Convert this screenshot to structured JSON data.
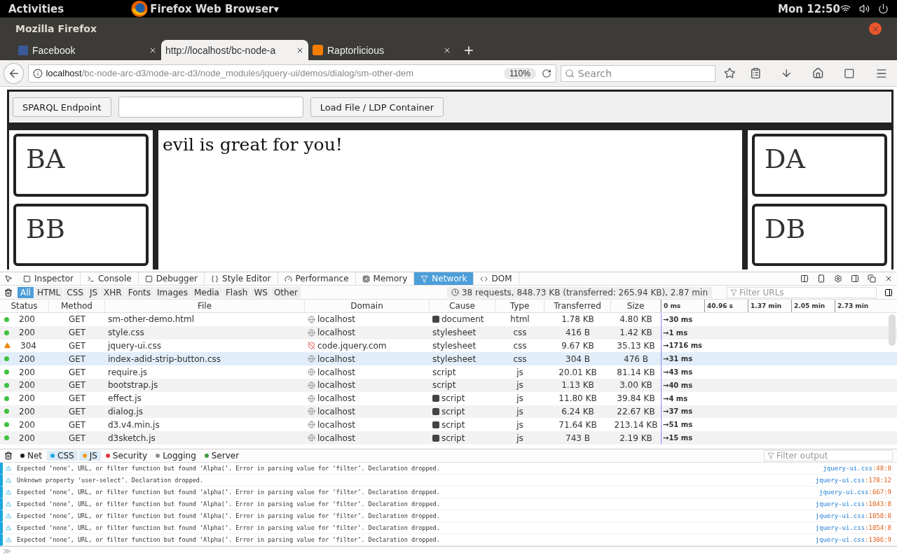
{
  "system_bar": {
    "activities": "Activities",
    "app_menu": "Firefox Web Browser▾",
    "clock": "Mon 12:50"
  },
  "window": {
    "title": "Mozilla Firefox"
  },
  "tabs": [
    {
      "label": "Facebook",
      "kind": "facebook",
      "selected": false
    },
    {
      "label": "http://localhost/bc-node-a",
      "kind": "page",
      "selected": true
    },
    {
      "label": "Raptorlicious",
      "kind": "blogger",
      "selected": false
    }
  ],
  "address_bar": {
    "host": "localhost",
    "path": "/bc-node-arc-d3/node-arc-d3/node_modules/jquery-ui/demos/dialog/sm-other-dem",
    "zoom": "110%"
  },
  "search": {
    "placeholder": "Search"
  },
  "page": {
    "toolbar": {
      "endpoint_button": "SPARQL Endpoint",
      "load_button": "Load File / LDP Container"
    },
    "left_boxes": [
      "BA",
      "BB"
    ],
    "main_text": "evil is great for you!",
    "right_boxes": [
      "DA",
      "DB"
    ]
  },
  "devtools": {
    "tabs": [
      {
        "label": "Inspector",
        "selected": false
      },
      {
        "label": "Console",
        "selected": false
      },
      {
        "label": "Debugger",
        "selected": false
      },
      {
        "label": "Style Editor",
        "selected": false
      },
      {
        "label": "Performance",
        "selected": false
      },
      {
        "label": "Memory",
        "selected": false
      },
      {
        "label": "Network",
        "selected": true
      },
      {
        "label": "DOM",
        "selected": false
      }
    ],
    "filters": [
      {
        "label": "All",
        "selected": true
      },
      {
        "label": "HTML",
        "selected": false
      },
      {
        "label": "CSS",
        "selected": false
      },
      {
        "label": "JS",
        "selected": false
      },
      {
        "label": "XHR",
        "selected": false
      },
      {
        "label": "Fonts",
        "selected": false
      },
      {
        "label": "Images",
        "selected": false
      },
      {
        "label": "Media",
        "selected": false
      },
      {
        "label": "Flash",
        "selected": false
      },
      {
        "label": "WS",
        "selected": false
      },
      {
        "label": "Other",
        "selected": false
      }
    ],
    "summary": "38 requests, 848.73 KB (transferred: 265.94 KB), 2.87 min",
    "filter_placeholder": "Filter URLs",
    "columns": [
      "Status",
      "Method",
      "File",
      "Domain",
      "Cause",
      "Type",
      "Transferred",
      "Size"
    ],
    "timeline_ticks": [
      "0 ms",
      "40.96 s",
      "1.37 min",
      "2.05 min",
      "2.73 min"
    ],
    "rows": [
      {
        "warning": false,
        "status": "200",
        "method": "GET",
        "file": "sm-other-demo.html",
        "insecure": false,
        "domain": "localhost",
        "cause_js": true,
        "cause": "document",
        "type": "html",
        "transferred": "1.78 KB",
        "size": "4.80 KB",
        "timing": "→30 ms",
        "selected": false
      },
      {
        "warning": false,
        "status": "200",
        "method": "GET",
        "file": "style.css",
        "insecure": false,
        "domain": "localhost",
        "cause_js": false,
        "cause": "stylesheet",
        "type": "css",
        "transferred": "416 B",
        "size": "1.42 KB",
        "timing": "→1 ms",
        "selected": false
      },
      {
        "warning": true,
        "status": "304",
        "method": "GET",
        "file": "jquery-ui.css",
        "insecure": true,
        "domain": "code.jquery.com",
        "cause_js": false,
        "cause": "stylesheet",
        "type": "css",
        "transferred": "9.67 KB",
        "size": "35.13 KB",
        "timing": "→1716 ms",
        "selected": false
      },
      {
        "warning": false,
        "status": "200",
        "method": "GET",
        "file": "index-adid-strip-button.css",
        "insecure": false,
        "domain": "localhost",
        "cause_js": false,
        "cause": "stylesheet",
        "type": "css",
        "transferred": "304 B",
        "size": "476 B",
        "timing": "→31 ms",
        "selected": true
      },
      {
        "warning": false,
        "status": "200",
        "method": "GET",
        "file": "require.js",
        "insecure": false,
        "domain": "localhost",
        "cause_js": false,
        "cause": "script",
        "type": "js",
        "transferred": "20.01 KB",
        "size": "81.14 KB",
        "timing": "→43 ms",
        "selected": false
      },
      {
        "warning": false,
        "status": "200",
        "method": "GET",
        "file": "bootstrap.js",
        "insecure": false,
        "domain": "localhost",
        "cause_js": false,
        "cause": "script",
        "type": "js",
        "transferred": "1.13 KB",
        "size": "3.00 KB",
        "timing": "→40 ms",
        "selected": false
      },
      {
        "warning": false,
        "status": "200",
        "method": "GET",
        "file": "effect.js",
        "insecure": false,
        "domain": "localhost",
        "cause_js": true,
        "cause": "script",
        "type": "js",
        "transferred": "11.80 KB",
        "size": "39.84 KB",
        "timing": "→4 ms",
        "selected": false
      },
      {
        "warning": false,
        "status": "200",
        "method": "GET",
        "file": "dialog.js",
        "insecure": false,
        "domain": "localhost",
        "cause_js": true,
        "cause": "script",
        "type": "js",
        "transferred": "6.24 KB",
        "size": "22.67 KB",
        "timing": "→37 ms",
        "selected": false
      },
      {
        "warning": false,
        "status": "200",
        "method": "GET",
        "file": "d3.v4.min.js",
        "insecure": false,
        "domain": "localhost",
        "cause_js": true,
        "cause": "script",
        "type": "js",
        "transferred": "71.64 KB",
        "size": "213.14 KB",
        "timing": "→51 ms",
        "selected": false
      },
      {
        "warning": false,
        "status": "200",
        "method": "GET",
        "file": "d3sketch.js",
        "insecure": false,
        "domain": "localhost",
        "cause_js": true,
        "cause": "script",
        "type": "js",
        "transferred": "743 B",
        "size": "2.19 KB",
        "timing": "→15 ms",
        "selected": false
      }
    ]
  },
  "console": {
    "filters": [
      {
        "label": "Net",
        "color": "#1a1a1a",
        "selected": false
      },
      {
        "label": "CSS",
        "color": "#1ba6e0",
        "selected": true
      },
      {
        "label": "JS",
        "color": "#f09c1a",
        "selected": true
      },
      {
        "label": "Security",
        "color": "#e5383b",
        "selected": false
      },
      {
        "label": "Logging",
        "color": "#8e8e8e",
        "selected": false
      },
      {
        "label": "Server",
        "color": "#3f9a3f",
        "selected": false
      }
    ],
    "filter_placeholder": "Filter output",
    "messages": [
      {
        "text": "Expected ‘none’, URL, or filter function but found ‘Alpha(’.  Error in parsing value for ‘filter’.  Declaration dropped.",
        "source": "jquery-ui.css",
        "position": ":48:8"
      },
      {
        "text": "Unknown property ‘user-select’.  Declaration dropped.",
        "source": "jquery-ui.css",
        "position": ":178:12"
      },
      {
        "text": "Expected ‘none’, URL, or filter function but found ‘alpha(’.  Error in parsing value for ‘filter’.  Declaration dropped.",
        "source": "jquery-ui.css",
        "position": ":667:9"
      },
      {
        "text": "Expected ‘none’, URL, or filter function but found ‘Alpha(’.  Error in parsing value for ‘filter’.  Declaration dropped.",
        "source": "jquery-ui.css",
        "position": ":1043:8"
      },
      {
        "text": "Expected ‘none’, URL, or filter function but found ‘Alpha(’.  Error in parsing value for ‘filter’.  Declaration dropped.",
        "source": "jquery-ui.css",
        "position": ":1050:8"
      },
      {
        "text": "Expected ‘none’, URL, or filter function but found ‘Alpha(’.  Error in parsing value for ‘filter’.  Declaration dropped.",
        "source": "jquery-ui.css",
        "position": ":1054:8"
      },
      {
        "text": "Expected ‘none’, URL, or filter function but found ‘Alpha(’.  Error in parsing value for ‘filter’.  Declaration dropped.",
        "source": "jquery-ui.css",
        "position": ":1306:9"
      }
    ],
    "prompt": "≫"
  }
}
